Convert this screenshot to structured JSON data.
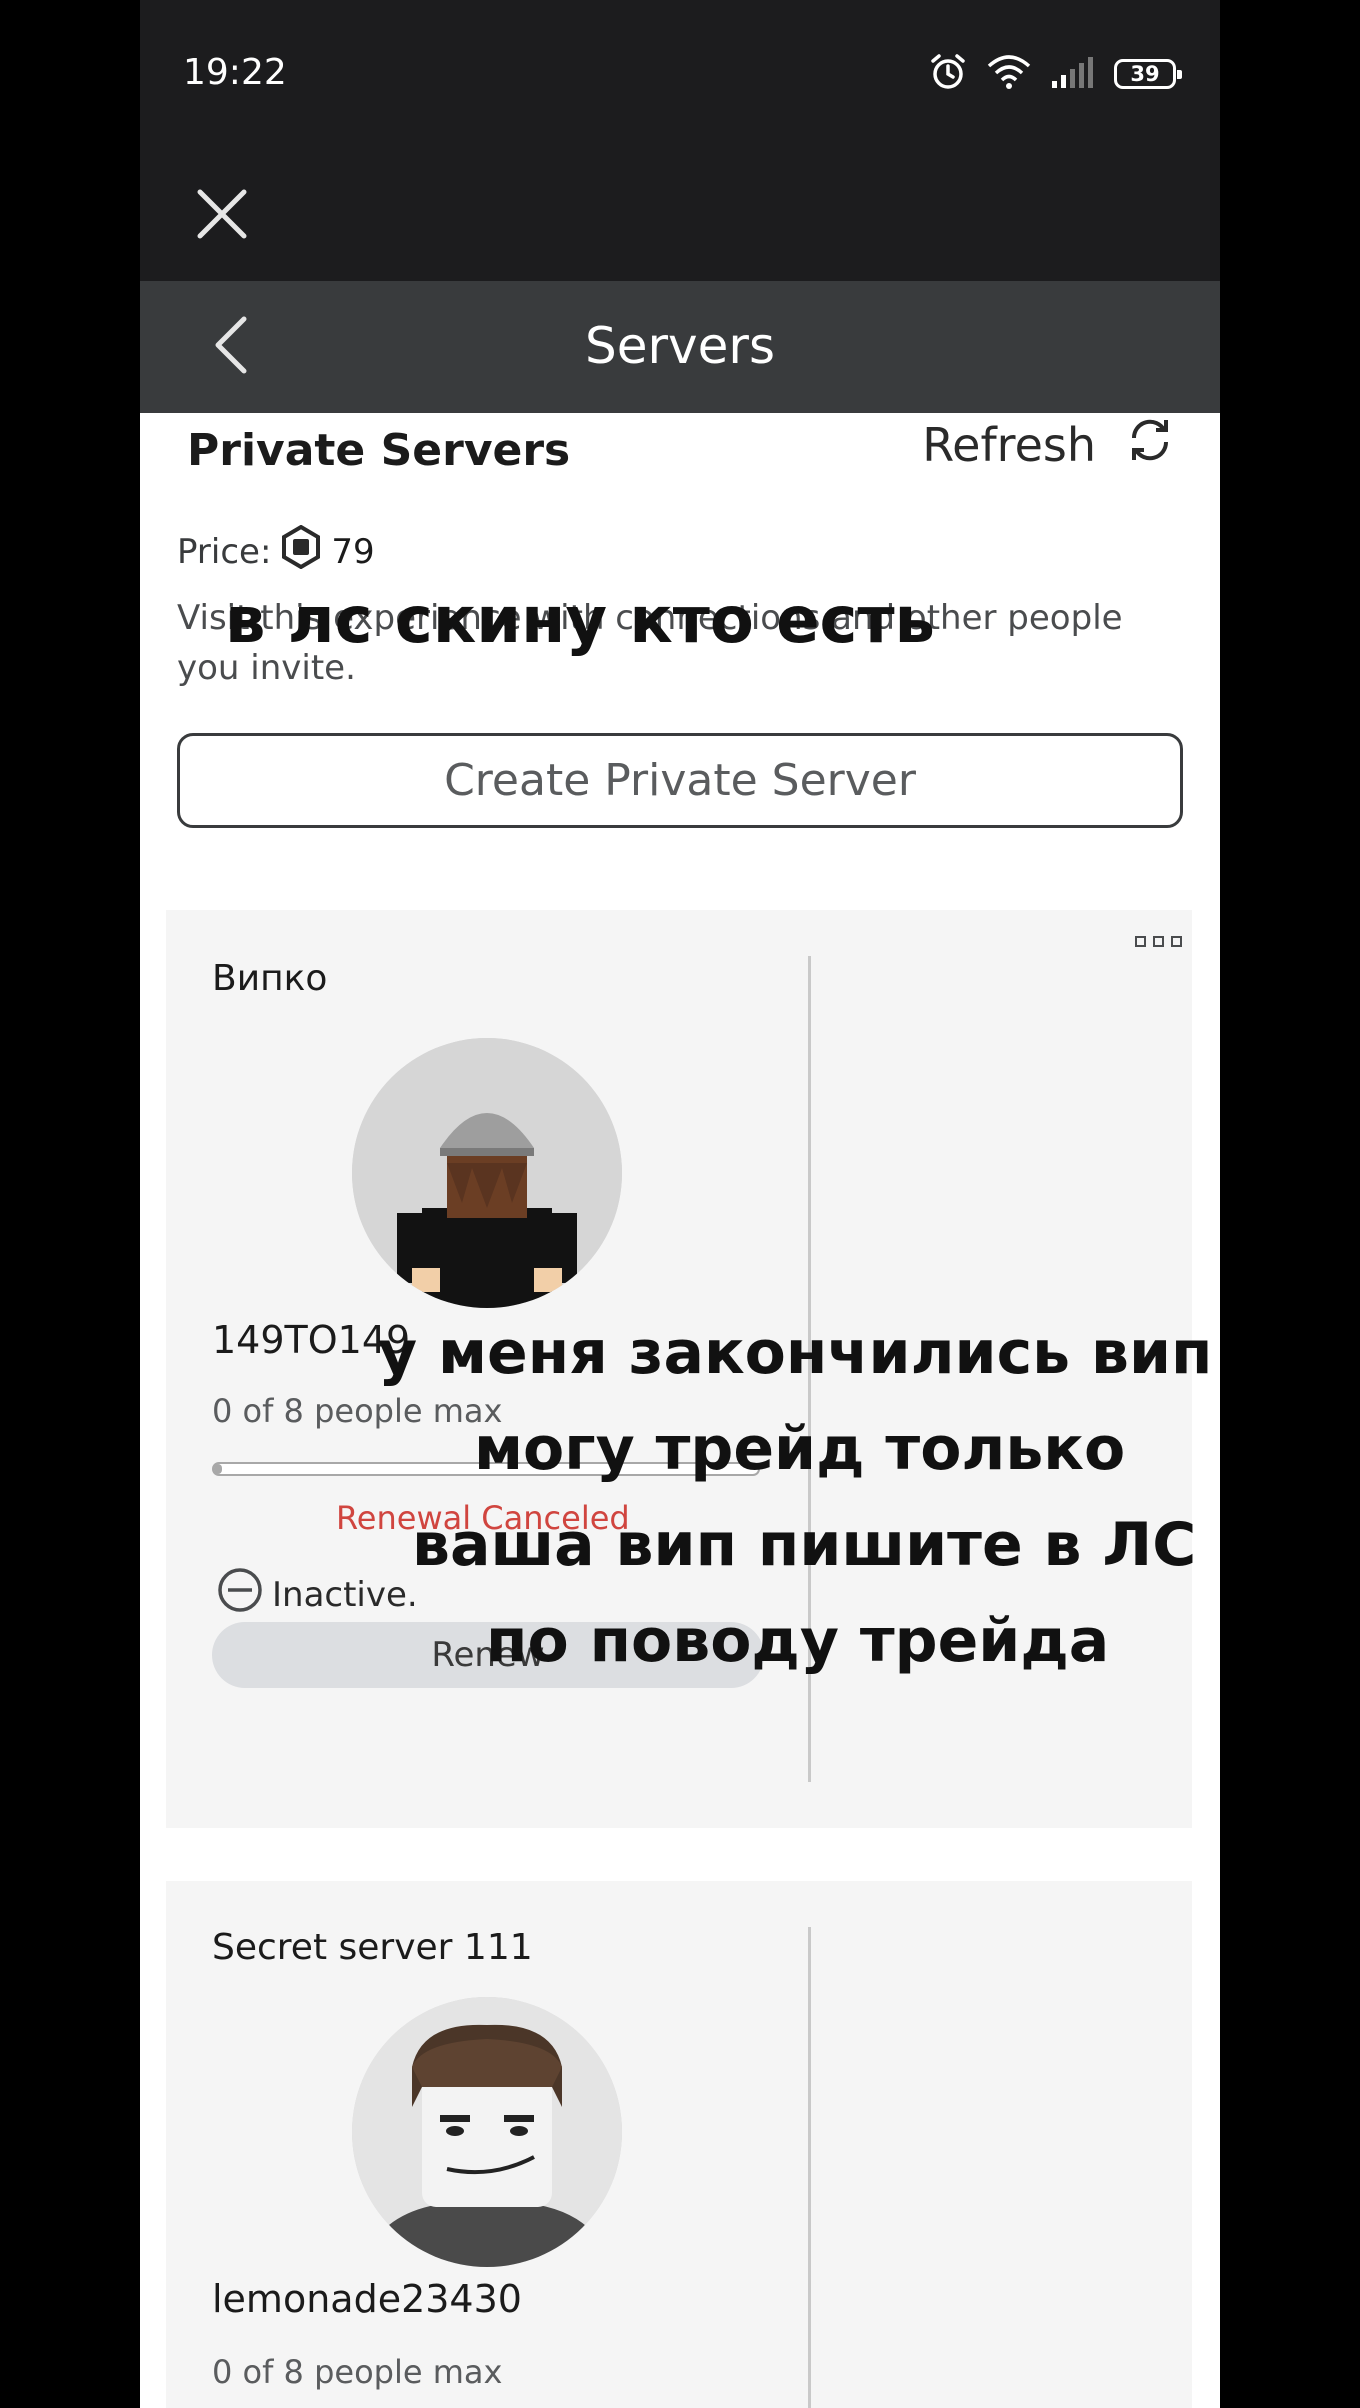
{
  "status_bar": {
    "time": "19:22",
    "battery": "39",
    "icons": [
      "alarm-icon",
      "wifi-icon",
      "signal-icon",
      "battery-icon"
    ]
  },
  "header": {
    "close_icon": "close-icon",
    "back_icon": "chevron-left-icon",
    "title": "Servers"
  },
  "private_servers": {
    "title": "Private Servers",
    "refresh_label": "Refresh",
    "price_label": "Price:",
    "price_value": "79",
    "description": "Visit this experience with connections and other people you invite.",
    "create_button": "Create Private Server"
  },
  "servers": [
    {
      "name": "Випко",
      "owner": "149TO149",
      "players": "0 of 8 people max",
      "renewal_status": "Renewal Canceled",
      "state": "Inactive.",
      "renew_button": "Renew",
      "player_fill": 0
    },
    {
      "name": "Secret server 111",
      "owner": "lemonade23430",
      "players": "0 of 8 people max"
    }
  ],
  "overlay_text": {
    "line1": "в лс скину кто есть",
    "line2": "у меня закончились вип",
    "line3": "могу трейд только",
    "line4": "ваша вип пишите в ЛС",
    "line5": "по поводу трейда"
  },
  "colors": {
    "topbar": "#1c1c1e",
    "titlebar": "#393b3d",
    "card": "#f5f5f5",
    "renewal_canceled": "#d0453f"
  }
}
